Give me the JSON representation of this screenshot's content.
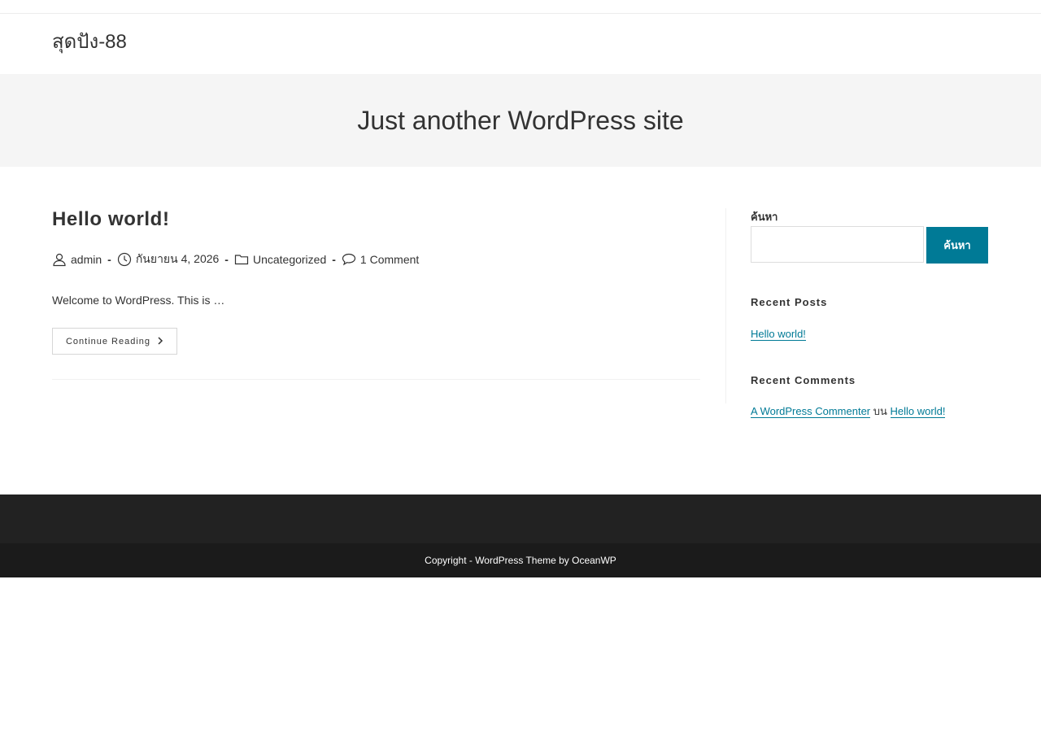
{
  "header": {
    "site_title": "สุดปัง-88"
  },
  "hero": {
    "tagline": "Just another WordPress site"
  },
  "post": {
    "title": "Hello world!",
    "meta": {
      "author": "admin",
      "date": "กันยายน 4, 2026",
      "category": "Uncategorized",
      "comments": "1 Comment",
      "separator": "-"
    },
    "excerpt": "Welcome to WordPress. This is …",
    "continue_label": "Continue Reading",
    "continue_icon": "chevron-right-icon"
  },
  "sidebar": {
    "search": {
      "label": "ค้นหา",
      "value": "",
      "button_label": "ค้นหา"
    },
    "recent_posts": {
      "title": "Recent Posts",
      "items": [
        {
          "label": "Hello world!"
        }
      ]
    },
    "recent_comments": {
      "title": "Recent Comments",
      "items": [
        {
          "author": "A WordPress Commenter",
          "connector": "บน",
          "post": "Hello world!"
        }
      ]
    }
  },
  "footer": {
    "copyright": "Copyright - WordPress Theme by OceanWP"
  },
  "colors": {
    "accent": "#007a96",
    "hero_bg": "#f5f5f5",
    "footer_bg": "#222222",
    "footer_bottom_bg": "#1b1b1b",
    "text": "#333333"
  },
  "icons": [
    "user-icon",
    "clock-icon",
    "folder-icon",
    "comment-icon",
    "chevron-right-icon"
  ]
}
